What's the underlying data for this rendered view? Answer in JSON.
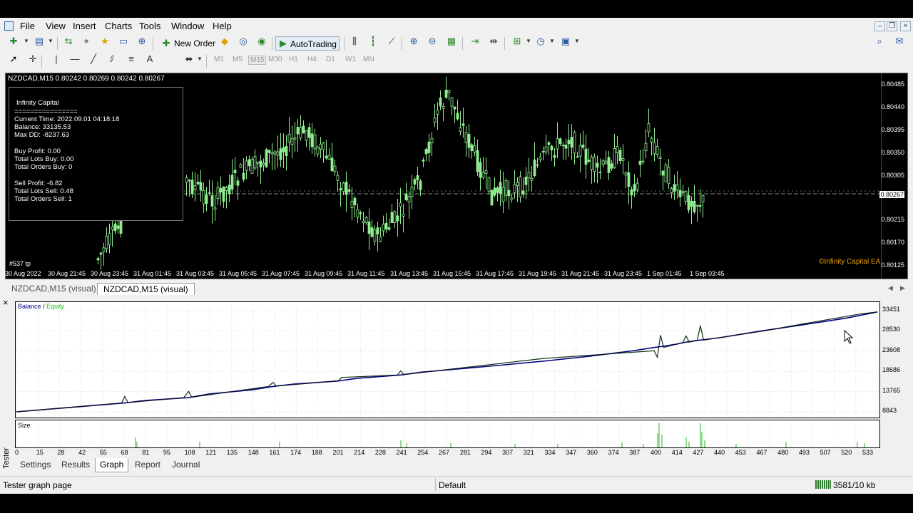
{
  "menu": [
    "File",
    "View",
    "Insert",
    "Charts",
    "Tools",
    "Window",
    "Help"
  ],
  "toolbar": {
    "new_order": "New Order",
    "autotrading": "AutoTrading",
    "timeframes": [
      "M1",
      "M5",
      "M15",
      "M30",
      "H1",
      "H4",
      "D1",
      "W1",
      "MN"
    ],
    "active_timeframe": "M15"
  },
  "chart": {
    "title": "NZDCAD,M15  0.80242 0.80269 0.80242 0.80267",
    "info": {
      "name": "Infinity Capital",
      "divider": "================",
      "current_time": "Current Time: 2022.09.01 04:18:18",
      "balance": "Balance: 33135.53",
      "max_dd": "Max DD: -8237.63",
      "buy_profit": "Buy Profit: 0.00",
      "total_lots_buy": "Total Lots Buy: 0.00",
      "total_orders_buy": "Total Orders Buy: 0",
      "sell_profit": "Sell Profit: -6.82",
      "total_lots_sell": "Total Lots Sell: 0.48",
      "total_orders_sell": "Total Orders Sell: 1"
    },
    "tp_label": "#537 tp",
    "watermark": "©Infinity Capital EA",
    "price_labels": [
      "0.80485",
      "0.80440",
      "0.80395",
      "0.80350",
      "0.80305",
      "0.80267",
      "0.80215",
      "0.80170",
      "0.80125"
    ],
    "current_price": "0.80267",
    "time_labels": [
      "30 Aug 2022",
      "30 Aug 21:45",
      "30 Aug 23:45",
      "31 Aug 01:45",
      "31 Aug 03:45",
      "31 Aug 05:45",
      "31 Aug 07:45",
      "31 Aug 09:45",
      "31 Aug 11:45",
      "31 Aug 13:45",
      "31 Aug 15:45",
      "31 Aug 17:45",
      "31 Aug 19:45",
      "31 Aug 21:45",
      "31 Aug 23:45",
      "1 Sep 01:45",
      "1 Sep 03:45"
    ],
    "colors": {
      "bull": "#90ee90",
      "bear": "#000000",
      "wick": "#90ee90"
    }
  },
  "chart_tabs": [
    "NZDCAD,M15 (visual)",
    "NZDCAD,M15 (visual)"
  ],
  "tester": {
    "side_label": "Tester",
    "graph": {
      "balance_label": "Balance",
      "separator": " / ",
      "equity_label": "Equity",
      "size_label": "Size",
      "y_labels": [
        "33451",
        "28530",
        "23608",
        "18686",
        "13765",
        "8843"
      ],
      "x_labels": [
        "0",
        "15",
        "28",
        "42",
        "55",
        "68",
        "81",
        "95",
        "108",
        "121",
        "135",
        "148",
        "161",
        "174",
        "188",
        "201",
        "214",
        "228",
        "241",
        "254",
        "267",
        "281",
        "294",
        "307",
        "321",
        "334",
        "347",
        "360",
        "374",
        "387",
        "400",
        "414",
        "427",
        "440",
        "453",
        "467",
        "480",
        "493",
        "507",
        "520",
        "533"
      ]
    },
    "tabs": [
      "Settings",
      "Results",
      "Graph",
      "Report",
      "Journal"
    ],
    "active_tab": "Graph"
  },
  "chart_data": [
    {
      "type": "line",
      "title": "",
      "series": [
        {
          "name": "Balance",
          "x": [
            0,
            68,
            81,
            108,
            121,
            148,
            161,
            174,
            201,
            214,
            241,
            254,
            281,
            307,
            334,
            360,
            387,
            400,
            404,
            414,
            420,
            427,
            440,
            467,
            493,
            520,
            540
          ],
          "values": [
            8843,
            11000,
            11600,
            12300,
            13200,
            14200,
            15000,
            15600,
            16300,
            17000,
            17800,
            18500,
            19400,
            20300,
            21300,
            22400,
            23700,
            24500,
            24700,
            25300,
            25800,
            26200,
            26800,
            28500,
            30000,
            31600,
            33135
          ]
        },
        {
          "name": "Equity",
          "x": [
            0,
            66,
            68,
            70,
            105,
            108,
            110,
            158,
            161,
            163,
            202,
            204,
            239,
            241,
            243,
            330,
            400,
            402,
            404,
            406,
            418,
            420,
            422,
            427,
            429,
            431,
            470,
            493,
            530,
            540
          ],
          "values": [
            8843,
            11000,
            12600,
            11100,
            12300,
            13800,
            12400,
            15000,
            16000,
            15100,
            16400,
            17200,
            17800,
            18800,
            17900,
            21800,
            23700,
            22100,
            27500,
            24500,
            25700,
            27300,
            25800,
            26200,
            29800,
            26300,
            28600,
            30200,
            32700,
            33135
          ]
        }
      ],
      "ylim": [
        8843,
        33451
      ],
      "xlim": [
        0,
        540
      ]
    }
  ],
  "statusbar": {
    "left": "Tester graph page",
    "profile": "Default",
    "traffic": "3581/10 kb"
  }
}
